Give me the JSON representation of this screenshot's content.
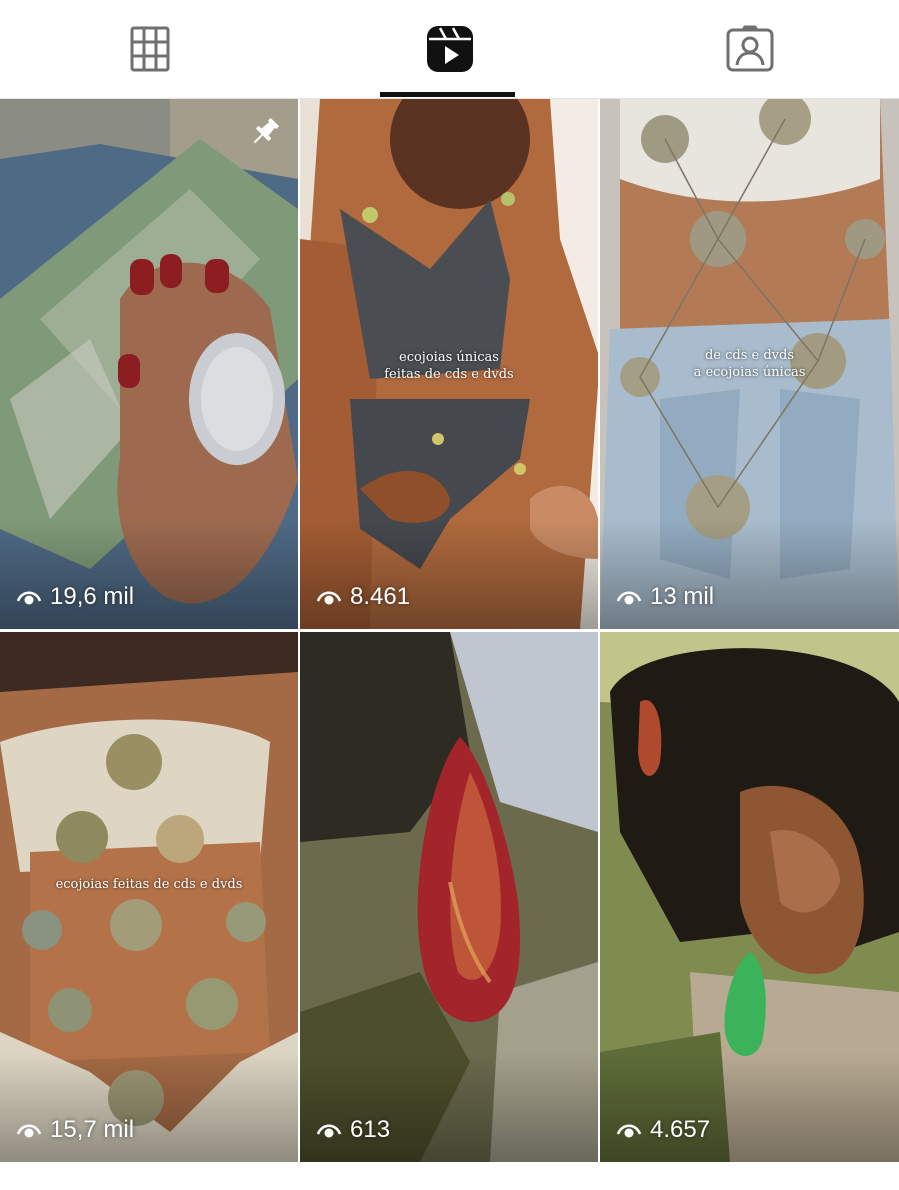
{
  "tabs": [
    {
      "name": "posts",
      "icon": "grid-icon",
      "active": false
    },
    {
      "name": "reels",
      "icon": "reels-icon",
      "active": true
    },
    {
      "name": "tagged",
      "icon": "tagged-person-icon",
      "active": false
    }
  ],
  "colors": {
    "icon_inactive": "#6f6f6f",
    "icon_active": "#111111",
    "text_overlay": "#ffffff"
  },
  "reels": [
    {
      "views": "19,6 mil",
      "pinned": true,
      "caption": ""
    },
    {
      "views": "8.461",
      "pinned": false,
      "caption": "ecojoias únicas\nfeitas de cds e dvds"
    },
    {
      "views": "13 mil",
      "pinned": false,
      "caption": "de cds e dvds\na ecojoias únicas"
    },
    {
      "views": "15,7 mil",
      "pinned": false,
      "caption": "ecojoias feitas de cds e dvds"
    },
    {
      "views": "613",
      "pinned": false,
      "caption": ""
    },
    {
      "views": "4.657",
      "pinned": false,
      "caption": ""
    }
  ],
  "icons": {
    "views": "eye-icon",
    "pinned": "pin-icon"
  }
}
